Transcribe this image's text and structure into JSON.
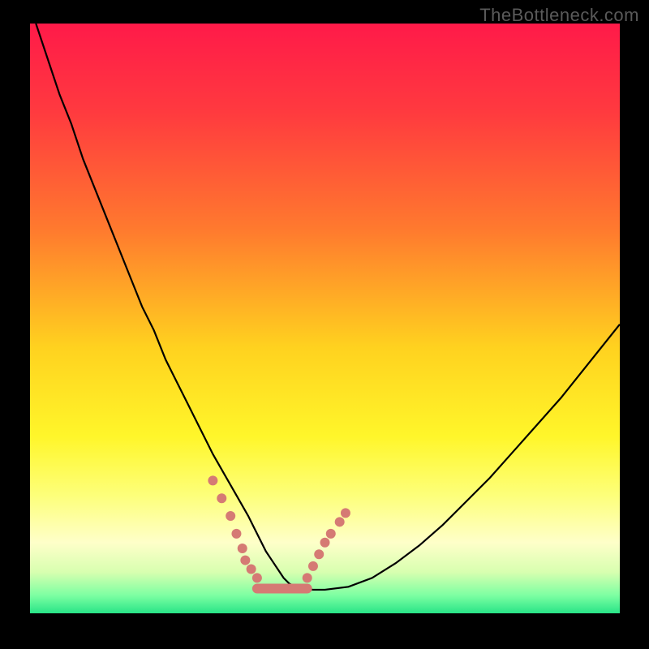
{
  "watermark": "TheBottleneck.com",
  "chart_data": {
    "type": "line",
    "title": "",
    "xlabel": "",
    "ylabel": "",
    "xlim": [
      0,
      100
    ],
    "ylim": [
      0,
      100
    ],
    "gradient_stops": [
      {
        "offset": 0,
        "color": "#ff1a49"
      },
      {
        "offset": 15,
        "color": "#ff3a3f"
      },
      {
        "offset": 35,
        "color": "#ff7a2e"
      },
      {
        "offset": 55,
        "color": "#ffd21f"
      },
      {
        "offset": 70,
        "color": "#fff62a"
      },
      {
        "offset": 80,
        "color": "#fdff7a"
      },
      {
        "offset": 88,
        "color": "#feffc9"
      },
      {
        "offset": 93,
        "color": "#d8ffb0"
      },
      {
        "offset": 97,
        "color": "#7cffa2"
      },
      {
        "offset": 100,
        "color": "#28e487"
      }
    ],
    "series": [
      {
        "name": "curve",
        "stroke": "#000000",
        "stroke_width": 2.2,
        "x": [
          1,
          3,
          5,
          7,
          9,
          11,
          13,
          15,
          17,
          19,
          21,
          23,
          25,
          27,
          29,
          31,
          33,
          35,
          37,
          38,
          39,
          40,
          41,
          42,
          43,
          44,
          46,
          48,
          50,
          54,
          58,
          62,
          66,
          70,
          74,
          78,
          82,
          86,
          90,
          94,
          98,
          100
        ],
        "y": [
          100,
          94,
          88,
          83,
          77,
          72,
          67,
          62,
          57,
          52,
          48,
          43,
          39,
          35,
          31,
          27,
          23.5,
          20,
          16.5,
          14.5,
          12.5,
          10.5,
          9,
          7.5,
          6,
          5,
          4.2,
          4.0,
          4.0,
          4.5,
          6,
          8.5,
          11.5,
          15,
          19,
          23,
          27.5,
          32,
          36.5,
          41.5,
          46.5,
          49
        ]
      }
    ],
    "markers": [
      {
        "name": "left-dip-markers",
        "color": "#d57a74",
        "radius": 6,
        "x": [
          31.0,
          32.5,
          34.0,
          35.0,
          36.0,
          36.5,
          37.5,
          38.5
        ],
        "y": [
          22.5,
          19.5,
          16.5,
          13.5,
          11.0,
          9.0,
          7.5,
          6.0
        ]
      },
      {
        "name": "right-dip-markers",
        "color": "#d57a74",
        "radius": 6,
        "x": [
          47.0,
          48.0,
          49.0,
          50.0,
          51.0,
          52.5,
          53.5
        ],
        "y": [
          6.0,
          8.0,
          10.0,
          12.0,
          13.5,
          15.5,
          17.0
        ]
      }
    ],
    "flat_segment": {
      "color": "#d57a74",
      "width": 12,
      "x1": 38.5,
      "y1": 4.2,
      "x2": 47.0,
      "y2": 4.2
    }
  }
}
